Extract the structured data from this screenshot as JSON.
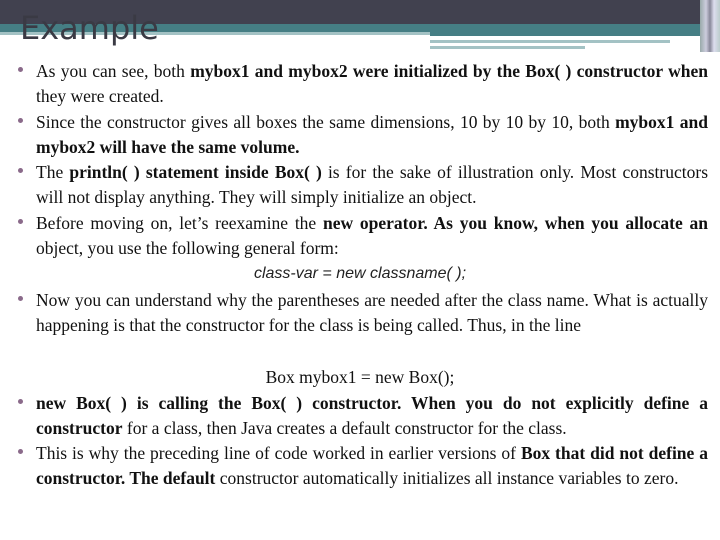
{
  "slide": {
    "title": "Example",
    "colors": {
      "header_dark": "#41414f",
      "header_teal": "#457e84",
      "header_light": "#a3c2c4",
      "bullet": "#8a6a8a"
    },
    "bullets": [
      {
        "segments": [
          {
            "text": "As you can see, both ",
            "bold": false
          },
          {
            "text": "mybox1 and mybox2 were initialized by the Box( ) constructor when",
            "bold": true
          },
          {
            "text": " they were created.",
            "bold": false
          }
        ]
      },
      {
        "segments": [
          {
            "text": "Since the constructor gives all boxes the same dimensions, 10 by 10 by 10, both ",
            "bold": false
          },
          {
            "text": "mybox1 and mybox2 will have the same volume.",
            "bold": true
          }
        ]
      },
      {
        "segments": [
          {
            "text": "The ",
            "bold": false
          },
          {
            "text": "println( ) statement inside Box( )",
            "bold": true
          },
          {
            "text": " is for the sake of illustration only. Most constructors will not display anything. They will simply initialize an object.",
            "bold": false
          }
        ]
      },
      {
        "segments": [
          {
            "text": "Before moving on, let’s reexamine the ",
            "bold": false
          },
          {
            "text": "new operator. As you know, when you allocate an",
            "bold": true
          },
          {
            "text": " object, you use the following general form:",
            "bold": false
          }
        ]
      },
      {
        "segments": [
          {
            "text": "Now you can understand why the parentheses are needed after the class name. What is actually happening is that the constructor for the class is being called. Thus, in the line",
            "bold": false
          }
        ]
      },
      {
        "segments": [
          {
            "text": "new Box( ) is calling the Box( ) constructor. When you do not explicitly define a constructor",
            "bold": true
          },
          {
            "text": " for a class, then Java creates a default constructor for the class.",
            "bold": false
          }
        ]
      },
      {
        "segments": [
          {
            "text": "This is why the preceding line of code worked in earlier versions of ",
            "bold": false
          },
          {
            "text": "Box that did not define a constructor. The default",
            "bold": true
          },
          {
            "text": " constructor automatically initializes all instance variables to zero.",
            "bold": false
          }
        ]
      }
    ],
    "formula": "class-var = new classname( );",
    "code_line": "Box mybox1 = new Box();"
  }
}
